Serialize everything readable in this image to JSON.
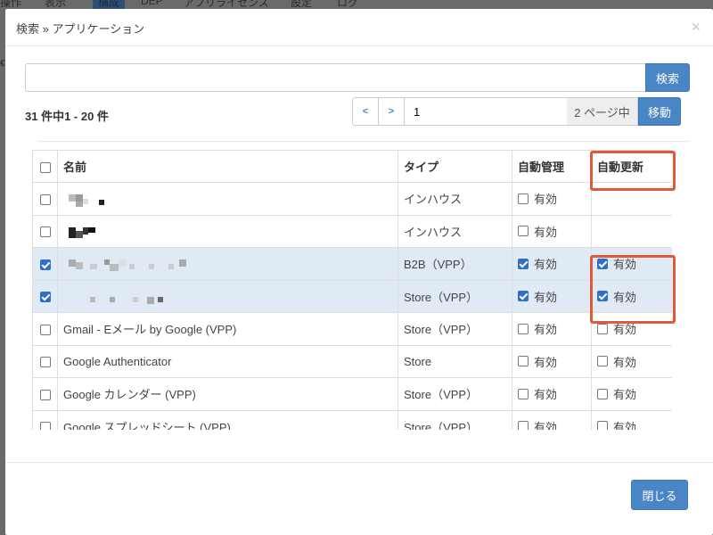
{
  "background_nav": {
    "items": [
      "操作",
      "表示",
      "構成",
      "DEP",
      "アプリライセンス",
      "設定",
      "ログ"
    ],
    "active_index": 2
  },
  "modal": {
    "title": "検索 » アプリケーション",
    "close_icon": "×"
  },
  "search": {
    "value": "",
    "placeholder": "",
    "button_label": "検索"
  },
  "results": {
    "count_text": "31 件中1 - 20 件"
  },
  "pager": {
    "prev_label": "<",
    "next_label": ">",
    "page_value": "1",
    "total_label": "2 ページ中",
    "go_label": "移動"
  },
  "table": {
    "headers": {
      "name": "名前",
      "type": "タイプ",
      "auto_manage": "自動管理",
      "auto_update": "自動更新"
    },
    "option_label": "有効",
    "rows": [
      {
        "name": "",
        "redacted": true,
        "type": "インハウス",
        "selected": false,
        "auto_manage": false,
        "auto_update": null
      },
      {
        "name": "",
        "redacted": true,
        "type": "インハウス",
        "selected": false,
        "auto_manage": false,
        "auto_update": null
      },
      {
        "name": "",
        "redacted": true,
        "type": "B2B（VPP）",
        "selected": true,
        "auto_manage": true,
        "auto_update": true
      },
      {
        "name": "",
        "redacted": true,
        "type": "Store（VPP）",
        "selected": true,
        "auto_manage": true,
        "auto_update": true
      },
      {
        "name": "Gmail - Eメール by Google (VPP)",
        "redacted": false,
        "type": "Store（VPP）",
        "selected": false,
        "auto_manage": false,
        "auto_update": false
      },
      {
        "name": "Google Authenticator",
        "redacted": false,
        "type": "Store",
        "selected": false,
        "auto_manage": false,
        "auto_update": false
      },
      {
        "name": "Google カレンダー (VPP)",
        "redacted": false,
        "type": "Store（VPP）",
        "selected": false,
        "auto_manage": false,
        "auto_update": false
      },
      {
        "name": "Google スプレッドシート (VPP)",
        "redacted": false,
        "type": "Store（VPP）",
        "selected": false,
        "auto_manage": false,
        "auto_update": false
      }
    ]
  },
  "footer": {
    "close_label": "閉じる"
  },
  "colors": {
    "accent": "#4a86c5",
    "selected_row": "#dfeaf5",
    "highlight": "#e05a3a",
    "checkbox_checked": "#2f6fc6"
  }
}
